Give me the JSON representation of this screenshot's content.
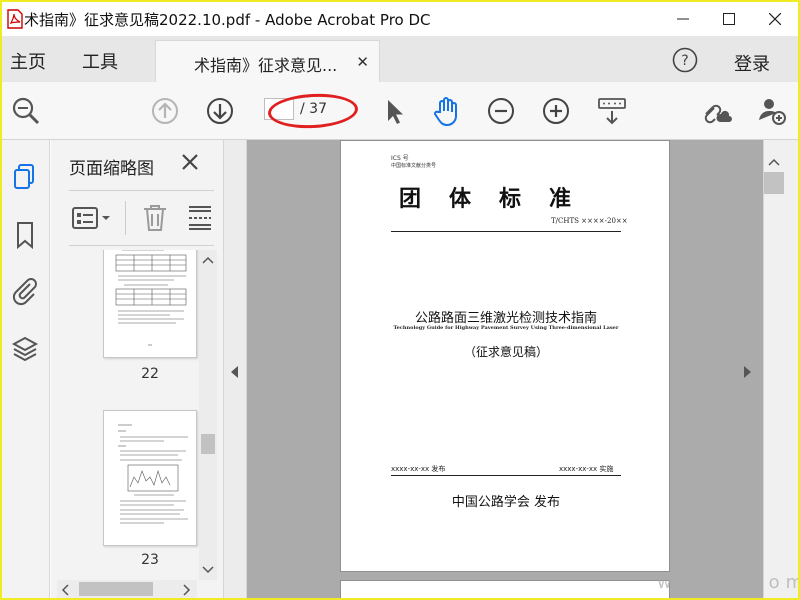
{
  "window": {
    "title": "术指南》征求意见稿2022.10.pdf - Adobe Acrobat Pro DC"
  },
  "menu": {
    "home": "主页",
    "tools": "工具",
    "doc_tab_label": "术指南》征求意见...",
    "login": "登录"
  },
  "toolbar": {
    "current_page": "",
    "total_pages": "/ 37"
  },
  "thumbnails_panel": {
    "title": "页面缩略图",
    "pages": [
      {
        "number": "22"
      },
      {
        "number": "23"
      }
    ]
  },
  "document": {
    "ics": "ICS 号",
    "class_no": "中国标准文献分类号",
    "standard_type": "团体标准",
    "standard_no": "T/CHTS ××××-20××",
    "title_cn": "公路路面三维激光检测技术指南",
    "title_en": "Technology Guide for Highway Pavement Survey Using Three-dimensional Laser",
    "draft_label": "（征求意见稿）",
    "publish_date": "xxxx-xx-xx 发布",
    "implement_date": "xxxx-xx-xx 实施",
    "publisher": "中国公路学会  发布"
  },
  "watermark": "www.    .com",
  "colors": {
    "border": "#f0ec24",
    "accent_blue": "#1473e6",
    "annotation_red": "#e02020"
  }
}
